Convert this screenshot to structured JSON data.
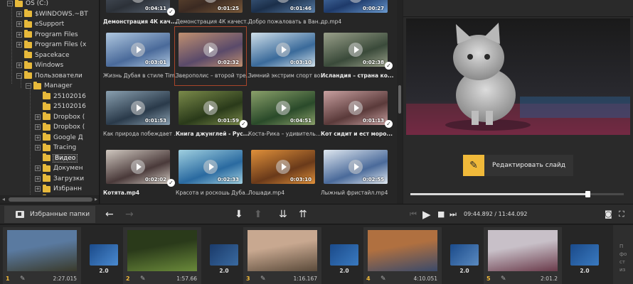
{
  "tree": {
    "items": [
      {
        "label": "OS (C:)",
        "level": 0,
        "exp": "−"
      },
      {
        "label": "$WINDOWS.~BT",
        "level": 1,
        "exp": "+"
      },
      {
        "label": "eSupport",
        "level": 1,
        "exp": "+"
      },
      {
        "label": "Program Files",
        "level": 1,
        "exp": "+"
      },
      {
        "label": "Program Files (x",
        "level": 1,
        "exp": "+"
      },
      {
        "label": "Spacekace",
        "level": 1,
        "exp": ""
      },
      {
        "label": "Windows",
        "level": 1,
        "exp": "+"
      },
      {
        "label": "Пользователи",
        "level": 1,
        "exp": "−"
      },
      {
        "label": "Manager",
        "level": 2,
        "exp": "−"
      },
      {
        "label": "25102016",
        "level": 3,
        "exp": ""
      },
      {
        "label": "25102016",
        "level": 3,
        "exp": ""
      },
      {
        "label": "Dropbox (",
        "level": 3,
        "exp": "+"
      },
      {
        "label": "Dropbox (",
        "level": 3,
        "exp": "+"
      },
      {
        "label": "Google Д",
        "level": 3,
        "exp": "+"
      },
      {
        "label": "Tracing",
        "level": 3,
        "exp": "+"
      },
      {
        "label": "Видео",
        "level": 3,
        "exp": "",
        "selected": true
      },
      {
        "label": "Докумен",
        "level": 3,
        "exp": "+"
      },
      {
        "label": "Загрузки",
        "level": 3,
        "exp": "+"
      },
      {
        "label": "Избранн",
        "level": 3,
        "exp": "+"
      },
      {
        "label": "Изобран",
        "level": 3,
        "exp": "+"
      }
    ]
  },
  "grid": {
    "items": [
      {
        "caption": "Демонстрация 4К кач...",
        "duration": "0:04:11",
        "check": true,
        "bold": true,
        "c1": "#2c3138",
        "c2": "#5a6472"
      },
      {
        "caption": "Демонстрация 4К качест...",
        "duration": "0:01:25",
        "check": false,
        "bold": false,
        "c1": "#3b2a22",
        "c2": "#7a5a3a"
      },
      {
        "caption": "Добро пожаловать в Ван...",
        "duration": "0:01:46",
        "check": false,
        "bold": false,
        "c1": "#1b2f4a",
        "c2": "#5a7fa8"
      },
      {
        "caption": "др.mp4",
        "duration": "0:00:27",
        "check": false,
        "bold": false,
        "c1": "#1e3a6a",
        "c2": "#6a9ad0"
      },
      {
        "caption": "Жизнь Дубая в стиле Tim...",
        "duration": "0:03:01",
        "check": false,
        "bold": false,
        "c1": "#4a6a9a",
        "c2": "#b0c8e0"
      },
      {
        "caption": "Зверополис – второй тре...",
        "duration": "0:02:32",
        "check": false,
        "bold": false,
        "c1": "#5a4a6a",
        "c2": "#c09070",
        "selected": true
      },
      {
        "caption": "Зимний экстрим спорт во...",
        "duration": "0:03:10",
        "check": false,
        "bold": false,
        "c1": "#3a6a9a",
        "c2": "#d0e0ea"
      },
      {
        "caption": "Исландия – страна ко...",
        "duration": "0:02:38",
        "check": true,
        "bold": true,
        "c1": "#3a4a3a",
        "c2": "#9aa08a"
      },
      {
        "caption": "Как природа побеждает ...",
        "duration": "0:01:53",
        "check": false,
        "bold": false,
        "c1": "#2a3a4a",
        "c2": "#8aa0b0"
      },
      {
        "caption": "Книга джунглей - Рус...",
        "duration": "0:01:59",
        "check": true,
        "bold": true,
        "c1": "#2a3a1a",
        "c2": "#7a8a4a"
      },
      {
        "caption": "Коста-Рика – удивитель...",
        "duration": "0:04:51",
        "check": false,
        "bold": false,
        "c1": "#2a4a2a",
        "c2": "#8aa06a"
      },
      {
        "caption": "Кот сидит и ест моро...",
        "duration": "0:01:13",
        "check": true,
        "bold": true,
        "c1": "#5a3a3a",
        "c2": "#c8a0a0"
      },
      {
        "caption": "Котята.mp4",
        "duration": "0:02:02",
        "check": true,
        "bold": true,
        "c1": "#4a3a3a",
        "c2": "#d0c8c0"
      },
      {
        "caption": "Красота и роскошь Дуба...",
        "duration": "0:02:33",
        "check": false,
        "bold": false,
        "c1": "#2a6aa0",
        "c2": "#a0d0e0"
      },
      {
        "caption": "Лошади.mp4",
        "duration": "0:03:10",
        "check": false,
        "bold": false,
        "c1": "#6a3a1a",
        "c2": "#e0903a"
      },
      {
        "caption": "Лыжный фристайл.mp4",
        "duration": "0:02:55",
        "check": false,
        "bold": false,
        "c1": "#4a6a9a",
        "c2": "#e0e8f0"
      }
    ]
  },
  "preview": {
    "edit_label": "Редактировать слайд",
    "seek_progress": 0.83
  },
  "toolbar": {
    "fav_label": "Избранные папки",
    "time": "09:44.892 / 11:44.092"
  },
  "timeline": {
    "slides": [
      {
        "num": "1",
        "duration": "2:27.015",
        "c1": "#5a7aa0",
        "c2": "#3a3a2a"
      },
      {
        "num": "2",
        "duration": "1:57.66",
        "c1": "#2a3a1a",
        "c2": "#6a8a3a"
      },
      {
        "num": "3",
        "duration": "1:16.167",
        "c1": "#c8a890",
        "c2": "#5a4a3a"
      },
      {
        "num": "4",
        "duration": "4:10.051",
        "c1": "#b07040",
        "c2": "#3a4a6a"
      },
      {
        "num": "5",
        "duration": "2:01.2",
        "c1": "#c8c0c8",
        "c2": "#6a3a4a"
      }
    ],
    "transitions": [
      {
        "value": "2.0",
        "c1": "#1a4a8a",
        "c2": "#4a8ad0"
      },
      {
        "value": "2.0",
        "c1": "#1a3a6a",
        "c2": "#3a6aa0"
      },
      {
        "value": "2.0",
        "c1": "#1a4a8a",
        "c2": "#3a7ac0"
      },
      {
        "value": "2.0",
        "c1": "#1a4a8a",
        "c2": "#5a8ac0"
      },
      {
        "value": "2.0",
        "c1": "#1a4a8a",
        "c2": "#3a7ac0"
      }
    ],
    "side": [
      "П",
      "фо",
      "ст",
      "из"
    ]
  }
}
